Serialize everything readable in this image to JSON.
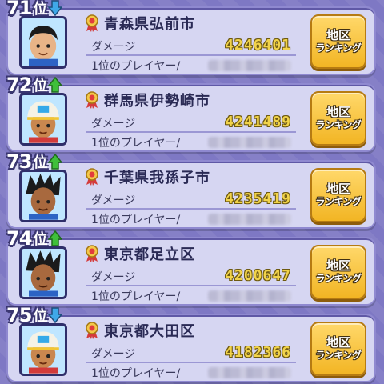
{
  "rows": [
    {
      "rank": "71",
      "rank_suffix": "位",
      "trend": "down",
      "region": "青森県弘前市",
      "damage_label": "ダメージ",
      "damage": "4246401",
      "player_label": "1位のプレイヤー/",
      "avatar": "dark-hair-boy",
      "button_line1": "地区",
      "button_line2": "ランキング"
    },
    {
      "rank": "72",
      "rank_suffix": "位",
      "trend": "up",
      "region": "群馬県伊勢崎市",
      "damage_label": "ダメージ",
      "damage": "4241489",
      "player_label": "1位のプレイヤー/",
      "avatar": "cap-boy",
      "button_line1": "地区",
      "button_line2": "ランキング"
    },
    {
      "rank": "73",
      "rank_suffix": "位",
      "trend": "up",
      "region": "千葉県我孫子市",
      "damage_label": "ダメージ",
      "damage": "4235419",
      "player_label": "1位のプレイヤー/",
      "avatar": "spiky-hair-boy",
      "button_line1": "地区",
      "button_line2": "ランキング"
    },
    {
      "rank": "74",
      "rank_suffix": "位",
      "trend": "up",
      "region": "東京都足立区",
      "damage_label": "ダメージ",
      "damage": "4200647",
      "player_label": "1位のプレイヤー/",
      "avatar": "spiky-hair-boy",
      "button_line1": "地区",
      "button_line2": "ランキング"
    },
    {
      "rank": "75",
      "rank_suffix": "位",
      "trend": "down",
      "region": "東京都大田区",
      "damage_label": "ダメージ",
      "damage": "4182366",
      "player_label": "1位のプレイヤー/",
      "avatar": "cap-boy",
      "button_line1": "地区",
      "button_line2": "ランキング"
    }
  ],
  "colors": {
    "trend_up": "#3fbf3a",
    "trend_down": "#3fa8e8",
    "damage_value": "#f1d34a",
    "button": "#f2b524"
  }
}
